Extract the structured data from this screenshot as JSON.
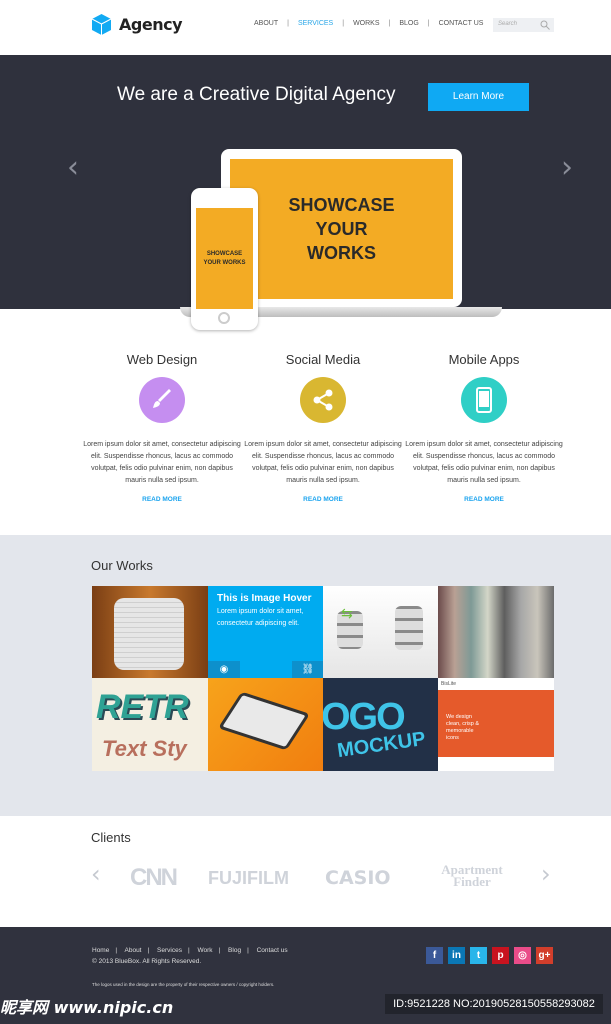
{
  "header": {
    "brand": "Agency",
    "nav": [
      "ABOUT",
      "SERVICES",
      "WORKS",
      "BLOG",
      "CONTACT US"
    ],
    "active_nav": "SERVICES",
    "search_placeholder": "Search"
  },
  "hero": {
    "title": "We are a Creative Digital Agency",
    "cta": "Learn More",
    "laptop_text": "SHOWCASE YOUR WORKS",
    "phone_text": "SHOWCASE YOUR WORKS"
  },
  "services": [
    {
      "title": "Web Design",
      "icon": "brush-icon",
      "color": "#c58ef0",
      "text": "Lorem ipsum dolor sit amet, consectetur adipiscing elit. Suspendisse rhoncus, lacus ac commodo volutpat, felis odio pulvinar enim, non dapibus mauris nulla sed ipsum.",
      "link": "READ MORE"
    },
    {
      "title": "Social Media",
      "icon": "share-icon",
      "color": "#d9b731",
      "text": "Lorem ipsum dolor sit amet, consectetur adipiscing elit. Suspendisse rhoncus, lacus ac commodo volutpat, felis odio pulvinar enim, non dapibus mauris nulla sed ipsum.",
      "link": "READ MORE"
    },
    {
      "title": "Mobile Apps",
      "icon": "smartphone-icon",
      "color": "#2fcfc6",
      "text": "Lorem ipsum dolor sit amet, consectetur adipiscing elit. Suspendisse rhoncus, lacus ac commodo volutpat, felis odio pulvinar enim, non dapibus mauris nulla sed ipsum.",
      "link": "READ MORE"
    }
  ],
  "works": {
    "title": "Our Works",
    "hover_title": "This is Image Hover",
    "hover_text": "Lorem ipsum dolor sit amet, consectetur adipiscing elit.",
    "retro_1": "RETR",
    "retro_2": "Text Sty",
    "logo_1": "OGO",
    "logo_2": "MOCKUP",
    "web_brand": "BisLite",
    "web_tagline": "We design clean, crisp & memorable icons"
  },
  "clients": {
    "title": "Clients",
    "logos": [
      "CNN",
      "FUJIFILM",
      "CASIO",
      "Apartment Finder"
    ]
  },
  "footer": {
    "links": [
      "Home",
      "About",
      "Services",
      "Work",
      "Blog",
      "Contact us"
    ],
    "copyright": "© 2013 BlueBox.  All Rights Reserved.",
    "disclaimer": "The logos used in the design are the property of their respective owners / copyright holders.",
    "social": [
      {
        "icon": "facebook-icon",
        "label": "f",
        "color": "#3b5998"
      },
      {
        "icon": "linkedin-icon",
        "label": "in",
        "color": "#0a77b5"
      },
      {
        "icon": "twitter-icon",
        "label": "t",
        "color": "#29b5ea"
      },
      {
        "icon": "pinterest-icon",
        "label": "p",
        "color": "#c8131f"
      },
      {
        "icon": "dribbble-icon",
        "label": "◎",
        "color": "#ea4c89"
      },
      {
        "icon": "googleplus-icon",
        "label": "g+",
        "color": "#d23e2b"
      }
    ]
  },
  "watermark": {
    "site": "昵享网 www.nipic.cn",
    "id": "ID:9521228 NO:20190528150558293082"
  }
}
